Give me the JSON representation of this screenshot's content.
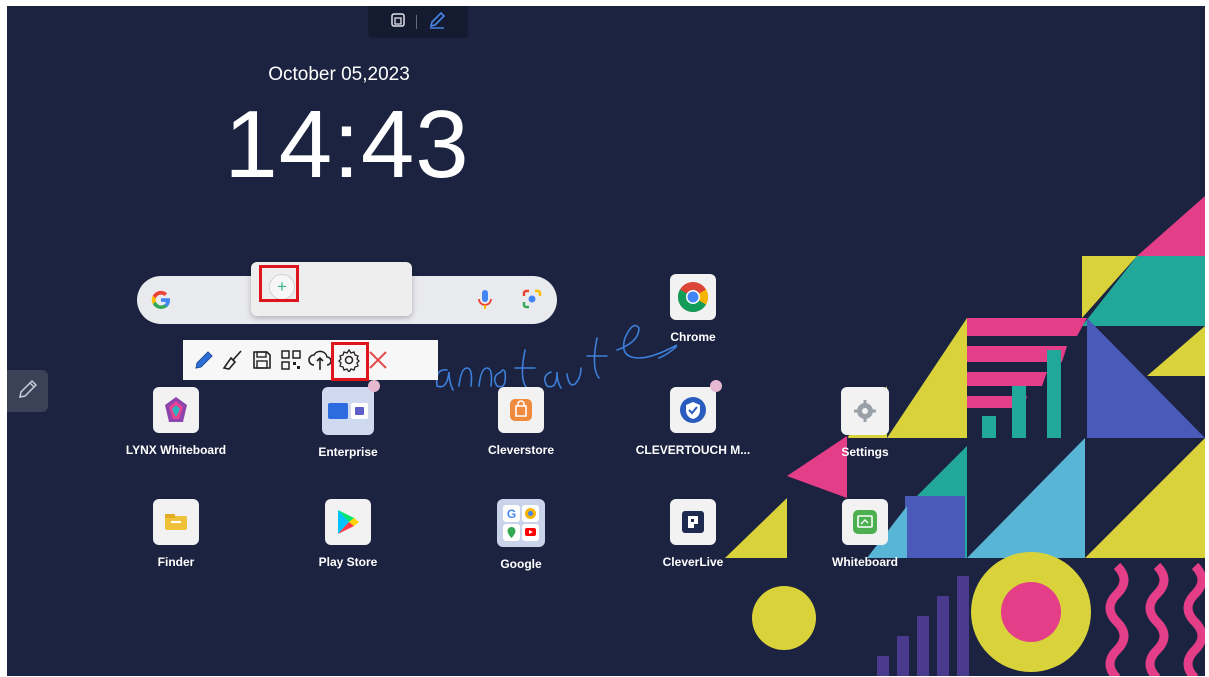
{
  "clock": {
    "date": "October 05,2023",
    "time": "14:43"
  },
  "search": {
    "google_icon": "google-g-icon",
    "mic_icon": "microphone-icon",
    "lens_icon": "google-lens-icon"
  },
  "add_popup": {
    "add_label": "+"
  },
  "annotation_text": "annotate",
  "annotation_toolbar": {
    "tools": [
      "pen-icon",
      "broom-eraser-icon",
      "save-icon",
      "qr-code-icon",
      "cloud-upload-icon",
      "settings-gear-icon",
      "close-icon"
    ],
    "active_tool": "pen-icon",
    "highlighted_tool": "cloud-upload-icon"
  },
  "apps": {
    "chrome": "Chrome",
    "lynx": "LYNX Whiteboard",
    "enterprise": "Enterprise",
    "cleverstore": "Cleverstore",
    "clevertouch": "CLEVERTOUCH M...",
    "settings": "Settings",
    "finder": "Finder",
    "playstore": "Play Store",
    "google": "Google",
    "cleverlive": "CleverLive",
    "whiteboard": "Whiteboard"
  },
  "colors": {
    "background": "#1c2340",
    "highlight_box": "#e0141b",
    "pink": "#e33e87",
    "yellow": "#d9d23a",
    "teal": "#22a89a",
    "blue": "#4a5ab8",
    "light_blue": "#59b5d6",
    "purple": "#5a3a8e",
    "annotation_ink": "#2e6fd6"
  }
}
